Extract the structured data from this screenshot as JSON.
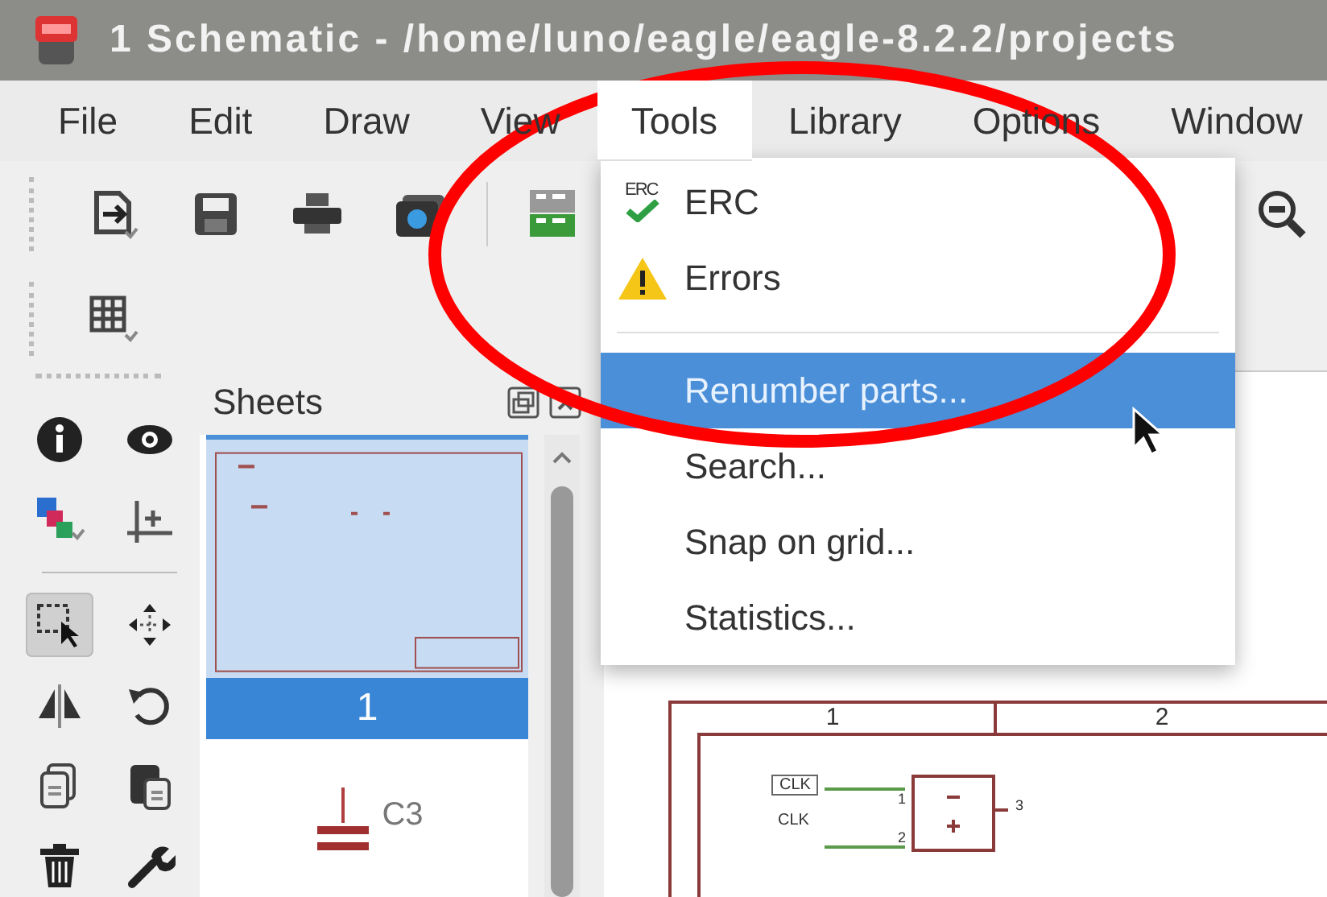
{
  "window": {
    "title": "1 Schematic - /home/luno/eagle/eagle-8.2.2/projects"
  },
  "menubar": [
    {
      "label": "File",
      "selected": false
    },
    {
      "label": "Edit",
      "selected": false
    },
    {
      "label": "Draw",
      "selected": false
    },
    {
      "label": "View",
      "selected": false
    },
    {
      "label": "Tools",
      "selected": true
    },
    {
      "label": "Library",
      "selected": false
    },
    {
      "label": "Options",
      "selected": false
    },
    {
      "label": "Window",
      "selected": false
    }
  ],
  "tools_menu": [
    {
      "kind": "erc",
      "label": "ERC",
      "icon_text": "ERC",
      "selected": false
    },
    {
      "kind": "warning",
      "label": "Errors",
      "selected": false
    },
    {
      "kind": "separator"
    },
    {
      "kind": "plain",
      "label": "Renumber parts...",
      "selected": true
    },
    {
      "kind": "plain",
      "label": "Search...",
      "selected": false
    },
    {
      "kind": "plain",
      "label": "Snap on grid...",
      "selected": false
    },
    {
      "kind": "plain",
      "label": "Statistics...",
      "selected": false
    }
  ],
  "left_tools": [
    {
      "kind": "info",
      "selected": false
    },
    {
      "kind": "eye",
      "selected": false
    },
    {
      "kind": "layers",
      "selected": false
    },
    {
      "kind": "origin",
      "selected": false
    },
    {
      "kind": "divider"
    },
    {
      "kind": "select",
      "selected": true
    },
    {
      "kind": "move",
      "selected": false
    },
    {
      "kind": "mirror",
      "selected": false
    },
    {
      "kind": "rotate",
      "selected": false
    },
    {
      "kind": "copy",
      "selected": false
    },
    {
      "kind": "paste",
      "selected": false
    },
    {
      "kind": "delete",
      "selected": false
    },
    {
      "kind": "wrench",
      "selected": false
    }
  ],
  "sheets_panel": {
    "title": "Sheets",
    "sheets": [
      {
        "label": "1",
        "selected": true
      }
    ],
    "part_label": "C3"
  },
  "schematic": {
    "columns": [
      "1",
      "2"
    ],
    "net_labels": [
      "CLK",
      "CLK"
    ],
    "pin_numbers": [
      "1",
      "2",
      "3"
    ]
  }
}
